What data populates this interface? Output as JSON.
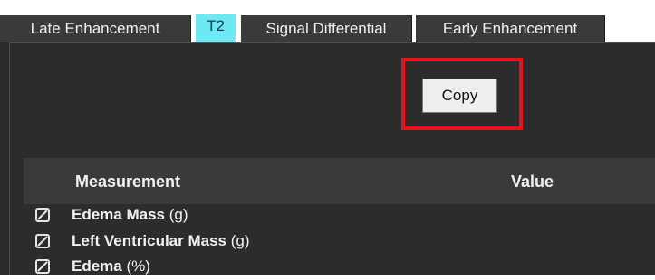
{
  "tabs": [
    {
      "label": "Late Enhancement",
      "active": false
    },
    {
      "label": "T2",
      "active": true
    },
    {
      "label": "Signal Differential",
      "active": false
    },
    {
      "label": "Early Enhancement",
      "active": false
    }
  ],
  "toolbar": {
    "copy_label": "Copy"
  },
  "table": {
    "headers": {
      "measurement": "Measurement",
      "value": "Value"
    },
    "rows": [
      {
        "name": "Edema Mass",
        "unit": "(g)",
        "checked": true
      },
      {
        "name": "Left Ventricular Mass",
        "unit": "(g)",
        "checked": true
      },
      {
        "name": "Edema",
        "unit": "(%)",
        "checked": true
      }
    ]
  },
  "colors": {
    "active_tab": "#6ee8f2",
    "highlight": "#e8121e",
    "background": "#2c2c2c"
  }
}
